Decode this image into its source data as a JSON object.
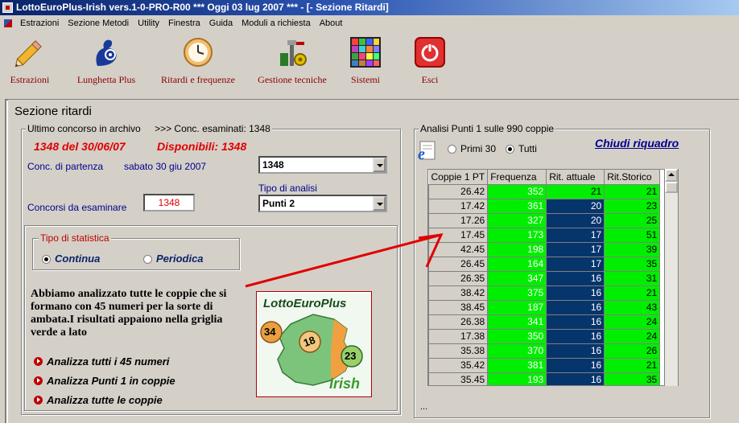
{
  "window": {
    "title": "LottoEuroPlus-Irish vers.1-0-PRO-R00  ***  Oggi 03 lug 2007  ***  - [- Sezione Ritardi]"
  },
  "menu": [
    "Estrazioni",
    "Sezione Metodi",
    "Utility",
    "Finestra",
    "Guida",
    "Moduli a richiesta",
    "About"
  ],
  "toolbar": [
    {
      "label": "Estrazioni",
      "icon": "pencil-icon"
    },
    {
      "label": "Lunghetta Plus",
      "icon": "lottery-hand-icon"
    },
    {
      "label": "Ritardi e frequenze",
      "icon": "clock-icon"
    },
    {
      "label": "Gestione tecniche",
      "icon": "tools-icon"
    },
    {
      "label": "Sistemi",
      "icon": "grid-icon"
    },
    {
      "label": "Esci",
      "icon": "power-icon"
    }
  ],
  "section_title": "Sezione ritardi",
  "left": {
    "archive_caption": "Ultimo concorso in archivo",
    "examined": ">>> Conc. esaminati: 1348",
    "last_contest": "1348   del 30/06/07",
    "available": "Disponibili: 1348",
    "start_label": "Conc. di partenza",
    "start_date": "sabato 30 giu 2007",
    "start_value": "1348",
    "analysis_label": "Tipo di analisi",
    "analysis_value": "Punti 2",
    "count_label": "Concorsi da esaminare",
    "count_value": "1348",
    "stat_caption": "Tipo di statistica",
    "stat_continua": "Continua",
    "stat_periodica": "Periodica",
    "description": "Abbiamo analizzato tutte le coppie che si formano con 45 numeri per la sorte di ambata.I risultati appaiono nella griglia verde a lato",
    "actions": [
      "Analizza tutti i 45 numeri",
      "Analizza Punti 1 in coppie",
      "Analizza tutte le coppie"
    ],
    "logo": {
      "title": "LottoEuroPlus",
      "balls": [
        "34",
        "18",
        "23"
      ],
      "subtitle": "Irish"
    }
  },
  "right": {
    "caption": "Analisi Punti 1 sulle 990 coppie",
    "radio_primi": "Primi 30",
    "radio_tutti": "Tutti",
    "close_link": "Chiudi riquadro",
    "footer": "...",
    "columns": [
      "Coppie 1 PT",
      "Frequenza",
      "Rit. attuale",
      "Rit.Storico"
    ],
    "rows": [
      [
        "26.42",
        "352",
        "21",
        "21"
      ],
      [
        "17.42",
        "361",
        "20",
        "23"
      ],
      [
        "17.26",
        "327",
        "20",
        "25"
      ],
      [
        "17.45",
        "173",
        "17",
        "51"
      ],
      [
        "42.45",
        "198",
        "17",
        "39"
      ],
      [
        "26.45",
        "164",
        "17",
        "35"
      ],
      [
        "26.35",
        "347",
        "16",
        "31"
      ],
      [
        "38.42",
        "375",
        "16",
        "21"
      ],
      [
        "38.45",
        "187",
        "16",
        "43"
      ],
      [
        "26.38",
        "341",
        "16",
        "24"
      ],
      [
        "17.38",
        "350",
        "16",
        "24"
      ],
      [
        "35.38",
        "370",
        "16",
        "26"
      ],
      [
        "35.42",
        "381",
        "16",
        "21"
      ],
      [
        "35.45",
        "193",
        "16",
        "35"
      ]
    ]
  },
  "colors": {
    "grid_green": "#00ee00",
    "grid_navy": "#06356c",
    "accent_red": "#e00000",
    "title_blue": "#0a246a"
  }
}
